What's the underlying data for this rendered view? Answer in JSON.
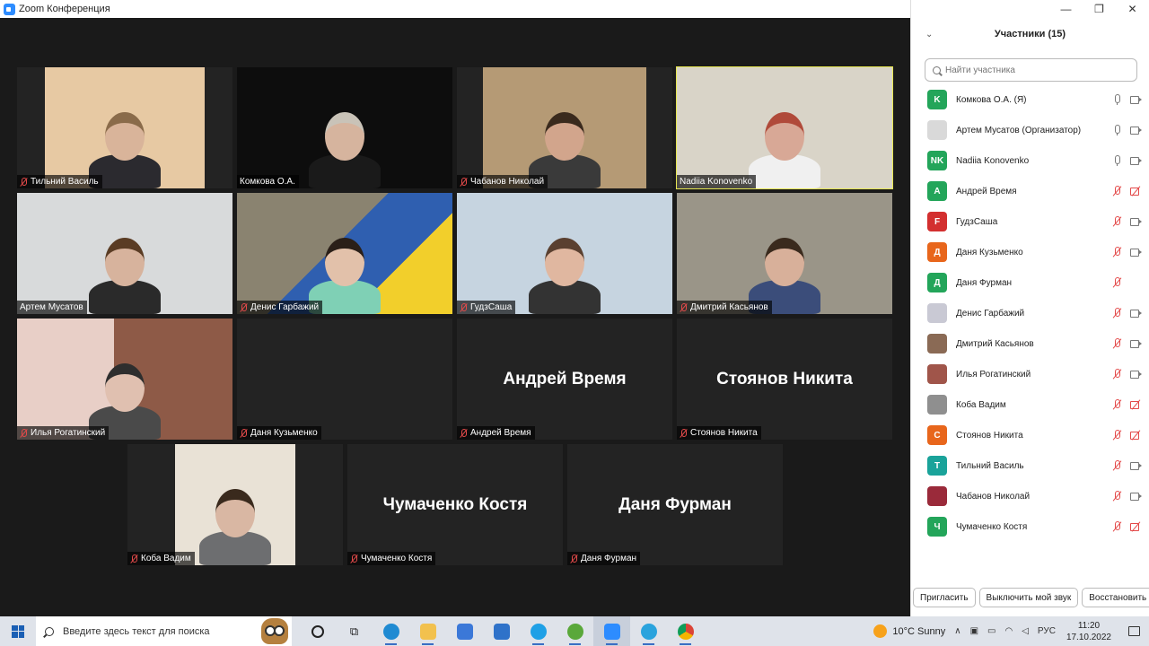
{
  "window": {
    "title": "Zoom Конференция"
  },
  "window_controls": {
    "minimize": "—",
    "maximize": "❐",
    "close": "✕"
  },
  "tiles": [
    {
      "name": "Тильний Василь",
      "muted": true,
      "video": true,
      "active": false
    },
    {
      "name": "Комкова О.А.",
      "muted": false,
      "video": true,
      "active": false
    },
    {
      "name": "Чабанов Николай",
      "muted": true,
      "video": true,
      "active": false
    },
    {
      "name": "Nadiia Konovenko",
      "muted": false,
      "video": true,
      "active": true
    },
    {
      "name": "Артем Мусатов",
      "muted": false,
      "video": true,
      "active": false
    },
    {
      "name": "Денис Гарбажий",
      "muted": true,
      "video": true,
      "active": false
    },
    {
      "name": "ГудзСаша",
      "muted": true,
      "video": true,
      "active": false
    },
    {
      "name": "Дмитрий Касьянов",
      "muted": true,
      "video": true,
      "active": false
    },
    {
      "name": "Илья Рогатинский",
      "muted": true,
      "video": true,
      "active": false
    },
    {
      "name": "Даня Кузьменко",
      "muted": true,
      "video": false,
      "bigname": "",
      "active": false
    },
    {
      "name": "Андрей Время",
      "muted": true,
      "video": false,
      "bigname": "Андрей Время",
      "active": false
    },
    {
      "name": "Стоянов Никита",
      "muted": true,
      "video": false,
      "bigname": "Стоянов Никита",
      "active": false
    },
    {
      "name": "Коба Вадим",
      "muted": true,
      "video": true,
      "active": false
    },
    {
      "name": "Чумаченко Костя",
      "muted": true,
      "video": false,
      "bigname": "Чумаченко Костя",
      "active": false
    },
    {
      "name": "Даня Фурман",
      "muted": true,
      "video": false,
      "bigname": "Даня Фурман",
      "active": false
    }
  ],
  "participants_panel": {
    "title": "Участники (15)",
    "search_placeholder": "Найти участника",
    "participants": [
      {
        "name": "Комкова О.А. (Я)",
        "initials": "K",
        "color": "#23a55a",
        "mic": "on",
        "cam": "on"
      },
      {
        "name": "Артем Мусатов (Организатор)",
        "initials": "",
        "color": "#d9d9d9",
        "mic": "on",
        "cam": "on"
      },
      {
        "name": "Nadiia Konovenko",
        "initials": "NK",
        "color": "#23a55a",
        "mic": "on",
        "cam": "on"
      },
      {
        "name": "Андрей Время",
        "initials": "A",
        "color": "#23a55a",
        "mic": "off",
        "cam": "off"
      },
      {
        "name": "ГудзСаша",
        "initials": "F",
        "color": "#d32f2f",
        "mic": "off",
        "cam": "on"
      },
      {
        "name": "Даня Кузьменко",
        "initials": "Д",
        "color": "#e8661c",
        "mic": "off",
        "cam": "on"
      },
      {
        "name": "Даня Фурман",
        "initials": "Д",
        "color": "#23a55a",
        "mic": "off",
        "cam": "none"
      },
      {
        "name": "Денис Гарбажий",
        "initials": "",
        "color": "#c9c9d4",
        "mic": "off",
        "cam": "on"
      },
      {
        "name": "Дмитрий Касьянов",
        "initials": "",
        "color": "#8a6a55",
        "mic": "off",
        "cam": "on"
      },
      {
        "name": "Илья Рогатинский",
        "initials": "",
        "color": "#a0554a",
        "mic": "off",
        "cam": "on"
      },
      {
        "name": "Коба Вадим",
        "initials": "",
        "color": "#8f8f8f",
        "mic": "off",
        "cam": "off"
      },
      {
        "name": "Стоянов Никита",
        "initials": "С",
        "color": "#e8661c",
        "mic": "off",
        "cam": "off"
      },
      {
        "name": "Тильний Василь",
        "initials": "T",
        "color": "#1aa39a",
        "mic": "off",
        "cam": "on"
      },
      {
        "name": "Чабанов Николай",
        "initials": "",
        "color": "#9a2a3a",
        "mic": "off",
        "cam": "on"
      },
      {
        "name": "Чумаченко Костя",
        "initials": "Ч",
        "color": "#23a55a",
        "mic": "off",
        "cam": "off"
      }
    ],
    "buttons": {
      "invite": "Пригласить",
      "mute_all": "Выключить мой звук",
      "restore": "Восстановить"
    }
  },
  "taskbar": {
    "search_placeholder": "Введите здесь текст для поиска",
    "weather": "10°C  Sunny",
    "language": "РУС",
    "time": "11:20",
    "date": "17.10.2022"
  }
}
